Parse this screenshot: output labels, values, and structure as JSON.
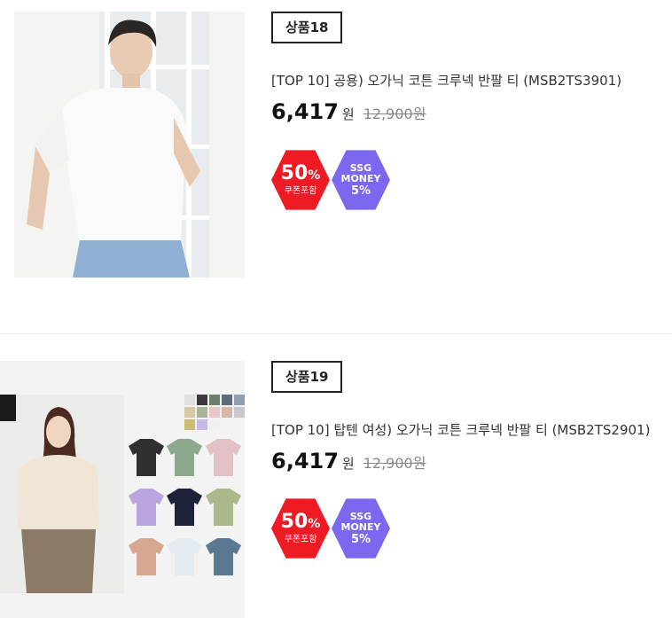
{
  "products": [
    {
      "rank": "상품18",
      "title": "[TOP 10] 공용) 오가닉 코튼 크루넥 반팔 티 (MSB2TS3901)",
      "sale_price": "6,417",
      "currency": "원",
      "original_price": "12,900원",
      "discount": {
        "value": "50",
        "unit": "%",
        "label": "쿠폰포함"
      },
      "ssg_money": {
        "line1": "SSG",
        "line2": "MONEY",
        "percent": "5%"
      }
    },
    {
      "rank": "상품19",
      "title": "[TOP 10] 탑텐 여성) 오가닉 코튼 크루넥 반팔 티 (MSB2TS2901)",
      "sale_price": "6,417",
      "currency": "원",
      "original_price": "12,900원",
      "discount": {
        "value": "50",
        "unit": "%",
        "label": "쿠폰포함"
      },
      "ssg_money": {
        "line1": "SSG",
        "line2": "MONEY",
        "percent": "5%"
      }
    }
  ],
  "colors": {
    "discount_badge": "#ee1b24",
    "ssg_badge": "#7b68ee",
    "swatches": [
      "#e0e0dc",
      "#3a3a3a",
      "#6d7e6a",
      "#5c6c7e",
      "#8fa0b2",
      "#d8c8a4",
      "#a8b496",
      "#e8c8c4",
      "#d4b8a8",
      "#c8c8cc",
      "#c8c070",
      "#c8b8e4",
      "#f0f0f0"
    ]
  }
}
